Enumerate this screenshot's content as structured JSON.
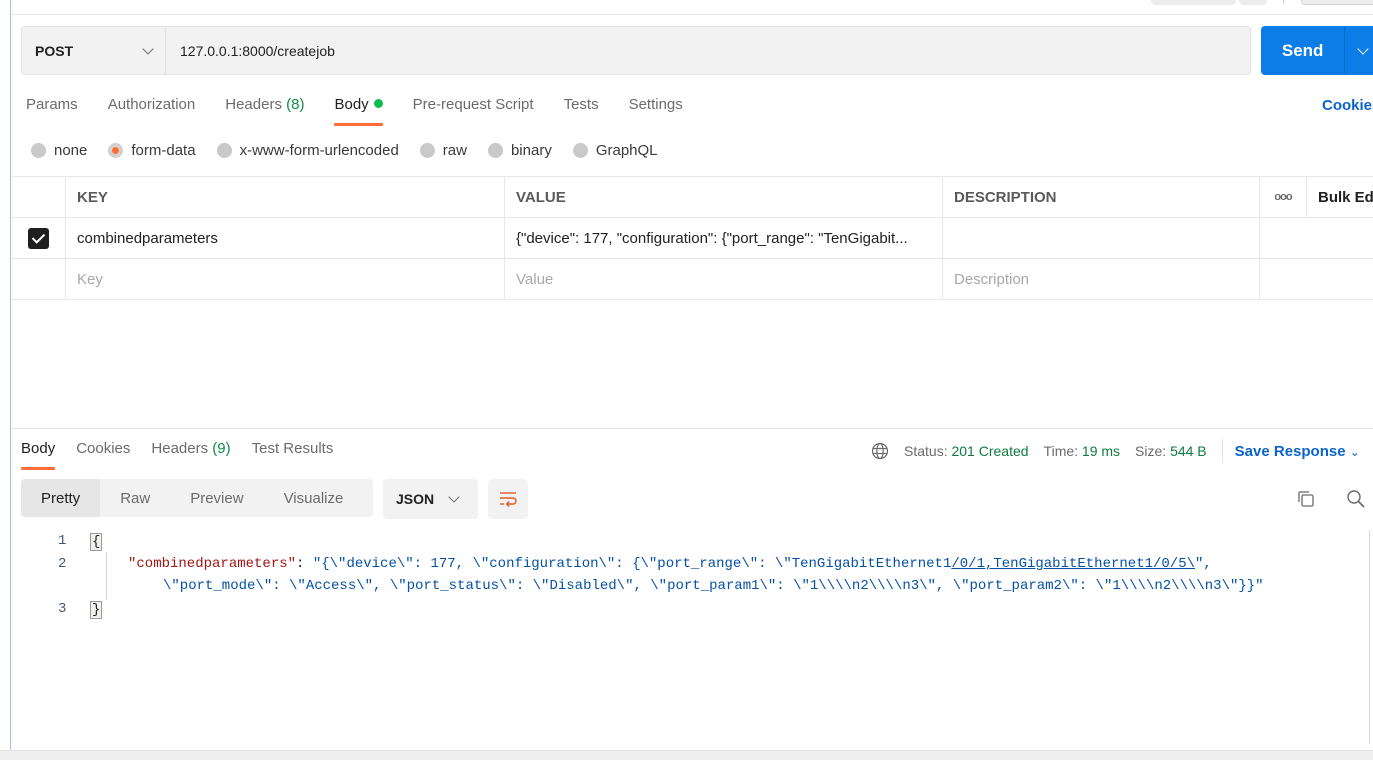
{
  "request": {
    "method": "POST",
    "url": "127.0.0.1:8000/createjob",
    "send_label": "Send",
    "tabs": [
      {
        "label": "Params"
      },
      {
        "label": "Authorization"
      },
      {
        "label": "Headers",
        "count": "(8)"
      },
      {
        "label": "Body",
        "active": true,
        "indicator": "green-dot"
      },
      {
        "label": "Pre-request Script"
      },
      {
        "label": "Tests"
      },
      {
        "label": "Settings"
      }
    ],
    "cookies_link": "Cookies",
    "body_types": [
      {
        "label": "none",
        "checked": false
      },
      {
        "label": "form-data",
        "checked": true
      },
      {
        "label": "x-www-form-urlencoded",
        "checked": false
      },
      {
        "label": "raw",
        "checked": false
      },
      {
        "label": "binary",
        "checked": false
      },
      {
        "label": "GraphQL",
        "checked": false
      }
    ],
    "table": {
      "headers": {
        "key": "KEY",
        "value": "VALUE",
        "description": "DESCRIPTION",
        "more": "ooo",
        "bulk_edit": "Bulk Edit"
      },
      "rows": [
        {
          "checked": true,
          "key": "combinedparameters",
          "value": "{\"device\": 177, \"configuration\": {\"port_range\": \"TenGigabit...",
          "description": ""
        }
      ],
      "placeholders": {
        "key": "Key",
        "value": "Value",
        "description": "Description"
      }
    }
  },
  "response": {
    "tabs": [
      {
        "label": "Body",
        "active": true
      },
      {
        "label": "Cookies"
      },
      {
        "label": "Headers",
        "count": "(9)"
      },
      {
        "label": "Test Results"
      }
    ],
    "status_label": "Status:",
    "status_value": "201 Created",
    "time_label": "Time:",
    "time_value": "19 ms",
    "size_label": "Size:",
    "size_value": "544 B",
    "save_response": "Save Response",
    "view_modes": [
      "Pretty",
      "Raw",
      "Preview",
      "Visualize"
    ],
    "active_view": "Pretty",
    "format": "JSON",
    "code": {
      "line_numbers": [
        "1",
        "2",
        "3"
      ],
      "open_brace": "{",
      "close_brace": "}",
      "key": "\"combinedparameters\"",
      "colon": ": ",
      "value_part1": "\"{\\\"device\\\": 177, \\\"configuration\\\": {\\\"port_range\\\": \\\"TenGigabitEthernet1",
      "value_link": "/0/1,TenGigabitEthernet1/0/5\\",
      "value_part1_end": "\",",
      "value_part2": "\\\"port_mode\\\": \\\"Access\\\", \\\"port_status\\\": \\\"Disabled\\\", \\\"port_param1\\\": \\\"1\\\\\\\\n2\\\\\\\\n3\\\", \\\"port_param2\\\": \\\"1\\\\\\\\n2\\\\\\\\n3\\\"}}\""
    }
  }
}
